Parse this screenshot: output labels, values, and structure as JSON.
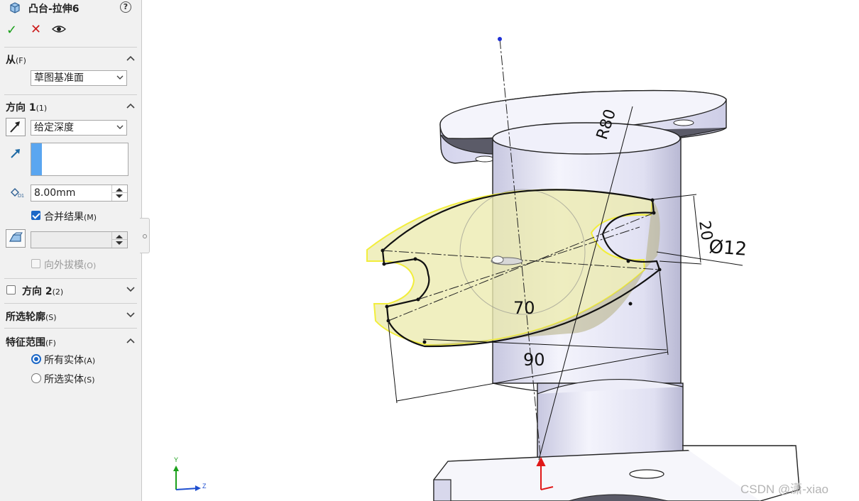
{
  "panel": {
    "title": "凸台-拉伸6",
    "help": "?",
    "from": {
      "header": "从",
      "header_key": "(F)",
      "select_value": "草图基准面"
    },
    "direction1": {
      "header": "方向 1",
      "header_key": "(1)",
      "end_condition": "给定深度",
      "depth": "8.00mm",
      "merge_label": "合并结果",
      "merge_key": "(M)",
      "merge_checked": true,
      "draft_value": "",
      "draft_outward_label": "向外拔模",
      "draft_outward_key": "(O)"
    },
    "direction2": {
      "header": "方向 2",
      "header_key": "(2)",
      "checked": false
    },
    "selected_contours": {
      "header": "所选轮廓",
      "header_key": "(S)"
    },
    "feature_scope": {
      "header": "特征范围",
      "header_key": "(F)",
      "options": [
        {
          "label": "所有实体",
          "key": "(A)",
          "selected": true
        },
        {
          "label": "所选实体",
          "key": "(S)",
          "selected": false
        }
      ]
    }
  },
  "viewport": {
    "dimensions": {
      "r80": "R80",
      "d20": "20",
      "phi12": "Ø12",
      "d70": "70",
      "d90": "90"
    },
    "triad": {
      "y": "Y",
      "z": "Z"
    }
  },
  "watermark": "CSDN @潇-xiao",
  "colors": {
    "check_green": "#19a019",
    "cancel_red": "#cc1c1c",
    "accent_blue": "#1c68c7",
    "preview_yellow": "#f2ee7a",
    "body_lavender": "#e9e9f8"
  }
}
